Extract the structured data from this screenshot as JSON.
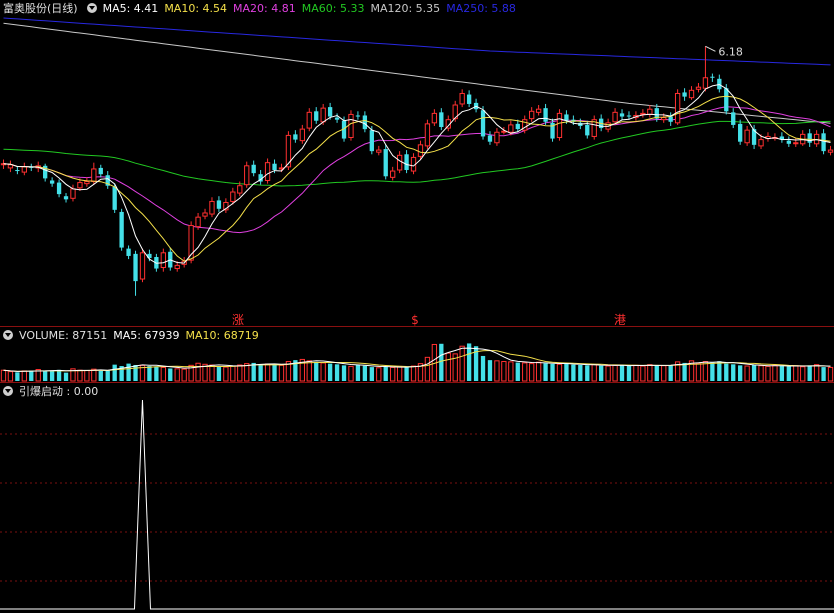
{
  "colors": {
    "ma5": "#ffffff",
    "ma10": "#f4e04a",
    "ma20": "#e040e0",
    "ma60": "#22c822",
    "ma120": "#c8c8c8",
    "ma250": "#2828e0",
    "up": "#ff3030",
    "down": "#44e0e8",
    "grid": "#7a1010",
    "text": "#e0e0e0"
  },
  "price_panel": {
    "stock_name": "富奥股份(日线)",
    "ma_labels": [
      {
        "key": "ma5",
        "label": "MA5: 4.41"
      },
      {
        "key": "ma10",
        "label": "MA10: 4.54"
      },
      {
        "key": "ma20",
        "label": "MA20: 4.81"
      },
      {
        "key": "ma60",
        "label": "MA60: 5.33"
      },
      {
        "key": "ma120",
        "label": "MA120: 5.35"
      },
      {
        "key": "ma250",
        "label": "MA250: 5.88"
      }
    ],
    "high_marker": "6.18",
    "event_markers": [
      "涨",
      "$",
      "港"
    ]
  },
  "volume_panel": {
    "labels": [
      {
        "key": "vol",
        "label": "VOLUME: 87151"
      },
      {
        "key": "ma5",
        "label": "MA5: 67939"
      },
      {
        "key": "ma10",
        "label": "MA10: 68719"
      }
    ]
  },
  "indicator_panel": {
    "label": "引爆启动 : 0.00"
  },
  "chart_data": [
    {
      "type": "candlestick",
      "title": "富奥股份(日线)",
      "ylim": [
        3.55,
        6.45
      ],
      "x": [
        1,
        2,
        3,
        4,
        5,
        6,
        7,
        8,
        9,
        10,
        11,
        12,
        13,
        14,
        15,
        16,
        17,
        18,
        19,
        20,
        21,
        22,
        23,
        24,
        25,
        26,
        27,
        28,
        29,
        30,
        31,
        32,
        33,
        34,
        35,
        36,
        37,
        38,
        39,
        40,
        41,
        42,
        43,
        44,
        45,
        46,
        47,
        48,
        49,
        50,
        51,
        52,
        53,
        54,
        55,
        56,
        57,
        58,
        59,
        60,
        61,
        62,
        63,
        64,
        65,
        66,
        67,
        68,
        69,
        70,
        71,
        72,
        73,
        74,
        75,
        76,
        77,
        78,
        79,
        80,
        81,
        82,
        83,
        84,
        85,
        86,
        87,
        88,
        89,
        90,
        91,
        92,
        93,
        94,
        95,
        96,
        97,
        98,
        99,
        100,
        101,
        102,
        103,
        104,
        105,
        106,
        107,
        108,
        109,
        110,
        111,
        112,
        113,
        114,
        115,
        116,
        117,
        118,
        119,
        120
      ],
      "close": [
        5.06,
        5.05,
        4.99,
        5.03,
        5.02,
        5.04,
        4.92,
        4.87,
        4.77,
        4.72,
        4.82,
        4.88,
        4.89,
        5.01,
        4.96,
        4.85,
        4.62,
        4.26,
        4.18,
        3.94,
        4.21,
        4.16,
        4.06,
        4.21,
        4.07,
        4.09,
        4.13,
        4.47,
        4.55,
        4.59,
        4.7,
        4.63,
        4.69,
        4.79,
        4.85,
        5.04,
        4.97,
        4.89,
        5.07,
        5.0,
        5.02,
        5.33,
        5.29,
        5.39,
        5.55,
        5.47,
        5.59,
        5.51,
        5.48,
        5.3,
        5.53,
        5.51,
        5.39,
        5.18,
        5.19,
        4.94,
        4.99,
        5.14,
        5.0,
        5.12,
        5.24,
        5.44,
        5.54,
        5.41,
        5.48,
        5.62,
        5.73,
        5.63,
        5.58,
        5.32,
        5.27,
        5.36,
        5.37,
        5.43,
        5.39,
        5.48,
        5.56,
        5.58,
        5.46,
        5.3,
        5.54,
        5.47,
        5.46,
        5.42,
        5.33,
        5.48,
        5.4,
        5.45,
        5.55,
        5.51,
        5.51,
        5.52,
        5.54,
        5.58,
        5.49,
        5.5,
        5.46,
        5.73,
        5.7,
        5.76,
        5.79,
        5.88,
        5.88,
        5.77,
        5.56,
        5.43,
        5.27,
        5.38,
        5.24,
        5.29,
        5.32,
        5.31,
        5.29,
        5.25,
        5.26,
        5.34,
        5.26,
        5.34,
        5.18,
        5.19
      ],
      "open": [
        5.05,
        5.02,
        5.0,
        4.98,
        5.03,
        5.02,
        5.04,
        4.9,
        4.88,
        4.75,
        4.73,
        4.83,
        4.87,
        4.89,
        5.02,
        4.95,
        4.84,
        4.6,
        4.25,
        4.2,
        3.96,
        4.2,
        4.17,
        4.07,
        4.22,
        4.06,
        4.1,
        4.14,
        4.46,
        4.56,
        4.58,
        4.71,
        4.62,
        4.7,
        4.78,
        4.86,
        5.05,
        4.96,
        4.9,
        5.06,
        5.01,
        5.03,
        5.34,
        5.28,
        5.4,
        5.56,
        5.46,
        5.6,
        5.5,
        5.47,
        5.31,
        5.52,
        5.52,
        5.38,
        5.17,
        5.2,
        4.93,
        5.0,
        5.15,
        4.99,
        5.13,
        5.23,
        5.45,
        5.55,
        5.4,
        5.49,
        5.63,
        5.72,
        5.64,
        5.57,
        5.33,
        5.26,
        5.37,
        5.36,
        5.44,
        5.38,
        5.49,
        5.55,
        5.59,
        5.45,
        5.31,
        5.53,
        5.48,
        5.45,
        5.43,
        5.32,
        5.49,
        5.39,
        5.46,
        5.54,
        5.52,
        5.5,
        5.53,
        5.53,
        5.59,
        5.48,
        5.51,
        5.45,
        5.74,
        5.69,
        5.77,
        5.78,
        5.89,
        5.87,
        5.78,
        5.55,
        5.44,
        5.26,
        5.39,
        5.23,
        5.3,
        5.31,
        5.32,
        5.28,
        5.26,
        5.25,
        5.35,
        5.25,
        5.35,
        5.17
      ],
      "high": [
        5.1,
        5.09,
        5.03,
        5.07,
        5.06,
        5.08,
        5.06,
        4.93,
        4.91,
        4.78,
        4.86,
        4.92,
        4.93,
        5.07,
        5.05,
        4.99,
        4.87,
        4.63,
        4.28,
        4.23,
        4.25,
        4.24,
        4.2,
        4.25,
        4.26,
        4.13,
        4.17,
        4.51,
        4.59,
        4.63,
        4.74,
        4.75,
        4.73,
        4.83,
        4.89,
        5.08,
        5.09,
        5.0,
        5.11,
        5.1,
        5.06,
        5.37,
        5.38,
        5.43,
        5.59,
        5.6,
        5.63,
        5.64,
        5.54,
        5.51,
        5.57,
        5.56,
        5.56,
        5.42,
        5.23,
        5.24,
        5.03,
        5.18,
        5.19,
        5.16,
        5.28,
        5.48,
        5.58,
        5.59,
        5.52,
        5.66,
        5.77,
        5.76,
        5.68,
        5.61,
        5.37,
        5.4,
        5.41,
        5.47,
        5.48,
        5.52,
        5.6,
        5.62,
        5.63,
        5.49,
        5.58,
        5.57,
        5.52,
        5.49,
        5.47,
        5.52,
        5.53,
        5.49,
        5.59,
        5.58,
        5.56,
        5.56,
        5.58,
        5.62,
        5.63,
        5.54,
        5.55,
        5.77,
        5.78,
        5.8,
        5.83,
        6.18,
        5.92,
        5.91,
        5.82,
        5.59,
        5.48,
        5.42,
        5.43,
        5.34,
        5.36,
        5.35,
        5.36,
        5.32,
        5.3,
        5.38,
        5.39,
        5.38,
        5.39,
        5.23
      ],
      "low": [
        5.01,
        4.98,
        4.96,
        4.95,
        4.99,
        4.98,
        4.89,
        4.84,
        4.74,
        4.69,
        4.7,
        4.8,
        4.84,
        4.86,
        4.93,
        4.82,
        4.59,
        4.23,
        4.15,
        3.8,
        3.93,
        4.13,
        4.03,
        4.03,
        4.04,
        4.03,
        4.07,
        4.11,
        4.43,
        4.53,
        4.55,
        4.6,
        4.59,
        4.67,
        4.75,
        4.83,
        4.94,
        4.86,
        4.87,
        4.97,
        4.98,
        5.0,
        5.26,
        5.25,
        5.37,
        5.44,
        5.43,
        5.48,
        5.45,
        5.27,
        5.28,
        5.48,
        5.36,
        5.15,
        5.14,
        4.91,
        4.9,
        4.97,
        4.97,
        4.96,
        5.1,
        5.2,
        5.42,
        5.38,
        5.37,
        5.46,
        5.6,
        5.6,
        5.55,
        5.29,
        5.24,
        5.23,
        5.34,
        5.33,
        5.36,
        5.35,
        5.46,
        5.52,
        5.43,
        5.27,
        5.28,
        5.44,
        5.43,
        5.39,
        5.3,
        5.29,
        5.37,
        5.36,
        5.43,
        5.48,
        5.48,
        5.47,
        5.5,
        5.5,
        5.46,
        5.45,
        5.42,
        5.43,
        5.66,
        5.67,
        5.74,
        5.75,
        5.84,
        5.74,
        5.53,
        5.4,
        5.24,
        5.23,
        5.2,
        5.2,
        5.27,
        5.28,
        5.26,
        5.22,
        5.22,
        5.23,
        5.22,
        5.22,
        5.15,
        5.14
      ],
      "volume": [
        31000,
        27000,
        25000,
        29000,
        30000,
        33000,
        28000,
        30000,
        32000,
        24000,
        35000,
        31000,
        30000,
        34000,
        29000,
        30000,
        47000,
        43000,
        50000,
        46000,
        45000,
        43000,
        42000,
        39000,
        36000,
        35000,
        34000,
        45000,
        51000,
        48000,
        46000,
        42000,
        40000,
        43000,
        46000,
        50000,
        52000,
        48000,
        49000,
        47000,
        45000,
        56000,
        60000,
        62000,
        58000,
        55000,
        52000,
        50000,
        48000,
        45000,
        42000,
        46000,
        44000,
        40000,
        38000,
        41000,
        39000,
        42000,
        40000,
        43000,
        50000,
        68000,
        105000,
        107000,
        80000,
        78000,
        100000,
        108000,
        100000,
        72000,
        60000,
        58000,
        56000,
        55000,
        53000,
        52000,
        50000,
        54000,
        51000,
        49000,
        48000,
        50000,
        47000,
        46000,
        45000,
        47000,
        44000,
        43000,
        45000,
        46000,
        44000,
        45000,
        43000,
        47000,
        45000,
        44000,
        46000,
        55000,
        52000,
        58000,
        50000,
        56000,
        53000,
        57000,
        50000,
        48000,
        45000,
        43000,
        46000,
        44000,
        42000,
        45000,
        43000,
        42000,
        44000,
        41000,
        45000,
        47000,
        40000,
        39000
      ],
      "volume_ylim": [
        0,
        115000
      ],
      "series_lines": [
        "ma5",
        "ma10",
        "ma20",
        "ma60",
        "ma120",
        "ma250"
      ],
      "ma_values": {
        "ma5": 4.41,
        "ma10": 4.54,
        "ma20": 4.81,
        "ma60": 5.33,
        "ma120": 5.35,
        "ma250": 5.88
      },
      "indicator": {
        "name": "引爆启动",
        "value": 0.0,
        "signal_index": 20,
        "signal_value": 1
      }
    }
  ]
}
